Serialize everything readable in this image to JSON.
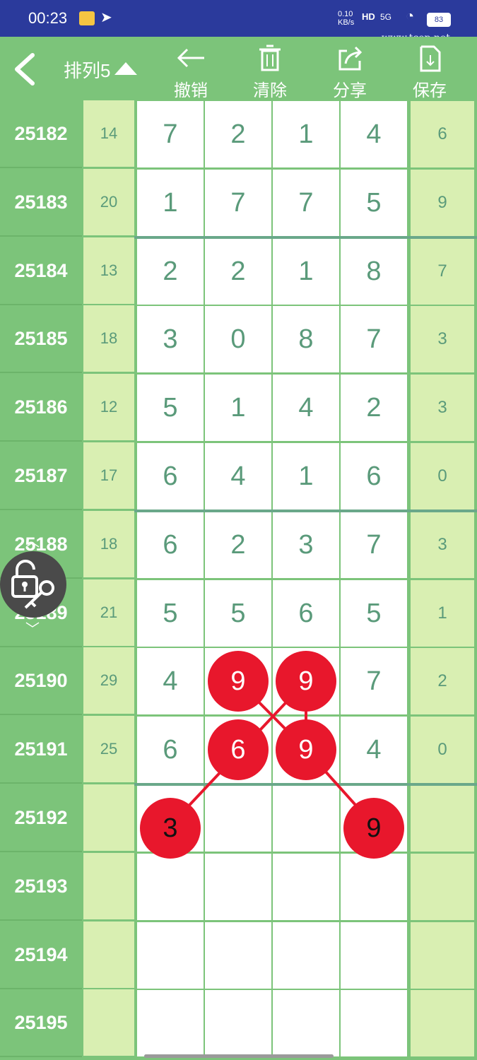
{
  "status": {
    "time": "00:23",
    "net_speed": "0.10 KB/s",
    "hd": "HD",
    "signal": "5G",
    "battery": "83"
  },
  "watermark": "www.tcep.net",
  "toolbar": {
    "title": "排列5",
    "buttons": [
      {
        "label": "撤销",
        "icon": "arrow-left-icon"
      },
      {
        "label": "清除",
        "icon": "trash-icon"
      },
      {
        "label": "分享",
        "icon": "share-icon"
      },
      {
        "label": "保存",
        "icon": "document-icon"
      }
    ]
  },
  "rows": [
    {
      "id": "25182",
      "sum": "14",
      "digits": [
        "7",
        "2",
        "1",
        "4"
      ],
      "last": "6"
    },
    {
      "id": "25183",
      "sum": "20",
      "digits": [
        "1",
        "7",
        "7",
        "5"
      ],
      "last": "9"
    },
    {
      "id": "25184",
      "sum": "13",
      "digits": [
        "2",
        "2",
        "1",
        "8"
      ],
      "last": "7"
    },
    {
      "id": "25185",
      "sum": "18",
      "digits": [
        "3",
        "0",
        "8",
        "7"
      ],
      "last": "3"
    },
    {
      "id": "25186",
      "sum": "12",
      "digits": [
        "5",
        "1",
        "4",
        "2"
      ],
      "last": "3"
    },
    {
      "id": "25187",
      "sum": "17",
      "digits": [
        "6",
        "4",
        "1",
        "6"
      ],
      "last": "0"
    },
    {
      "id": "25188",
      "sum": "18",
      "digits": [
        "6",
        "2",
        "3",
        "7"
      ],
      "last": "3"
    },
    {
      "id": "25189",
      "sum": "21",
      "digits": [
        "5",
        "5",
        "6",
        "5"
      ],
      "last": "1"
    },
    {
      "id": "25190",
      "sum": "29",
      "digits": [
        "4",
        "",
        "",
        "7"
      ],
      "last": "2"
    },
    {
      "id": "25191",
      "sum": "25",
      "digits": [
        "6",
        "",
        "",
        "4"
      ],
      "last": "0"
    },
    {
      "id": "25192",
      "sum": "",
      "digits": [
        "",
        "",
        "",
        ""
      ],
      "last": ""
    },
    {
      "id": "25193",
      "sum": "",
      "digits": [
        "",
        "",
        "",
        ""
      ],
      "last": ""
    },
    {
      "id": "25194",
      "sum": "",
      "digits": [
        "",
        "",
        "",
        ""
      ],
      "last": ""
    },
    {
      "id": "25195",
      "sum": "",
      "digits": [
        "",
        "",
        "",
        ""
      ],
      "last": ""
    }
  ],
  "marks": [
    {
      "row": 8,
      "col": 1,
      "value": "9"
    },
    {
      "row": 8,
      "col": 2,
      "value": "9"
    },
    {
      "row": 9,
      "col": 1,
      "value": "6"
    },
    {
      "row": 9,
      "col": 2,
      "value": "9"
    },
    {
      "row": 10,
      "col": 0,
      "value": "3"
    },
    {
      "row": 10,
      "col": 3,
      "value": "9"
    }
  ],
  "colors": {
    "header_green": "#7cc47a",
    "status_blue": "#2b3a9c",
    "light_green": "#d9efb2",
    "digit": "#5a9a7a",
    "mark_red": "#e8172c"
  }
}
